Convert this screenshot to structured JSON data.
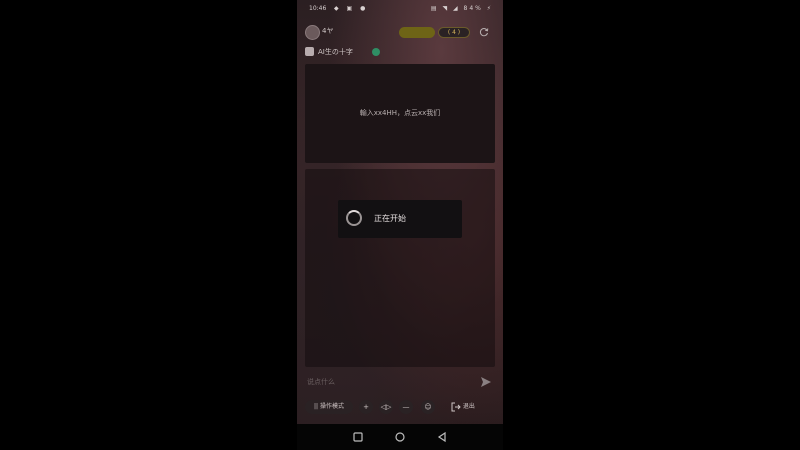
{
  "status_bar": {
    "time": "10:46",
    "left_icons": "◆ ▣ ●",
    "right_icons": "▤ ◥ ◢ 84% ⚡"
  },
  "top_bar": {
    "nickname": "4ヤ",
    "gold_pill_label": "",
    "dark_pill_label": "( 4 )"
  },
  "title_row": {
    "title": "AI生の十字"
  },
  "hint_card": {
    "text": "輸入xx4HH，点云xx我们"
  },
  "loading": {
    "label": "正在开始"
  },
  "input": {
    "placeholder": "说点什么"
  },
  "toolbar": {
    "mode_button": "|| 操作模式",
    "circle_1": "+",
    "circle_2": "◁▷",
    "circle_3": "—",
    "circle_4": "☺",
    "exit_label": "退出"
  },
  "colors": {
    "gold_pill_bg": "#6e6416",
    "leaf_green": "#2f8e64",
    "bg_dark": "#2b1f22"
  },
  "icons": [
    "refresh-icon",
    "bot-icon",
    "leaf-icon",
    "send-icon",
    "exit-icon",
    "nav-square-icon",
    "nav-home-icon",
    "nav-back-icon"
  ]
}
